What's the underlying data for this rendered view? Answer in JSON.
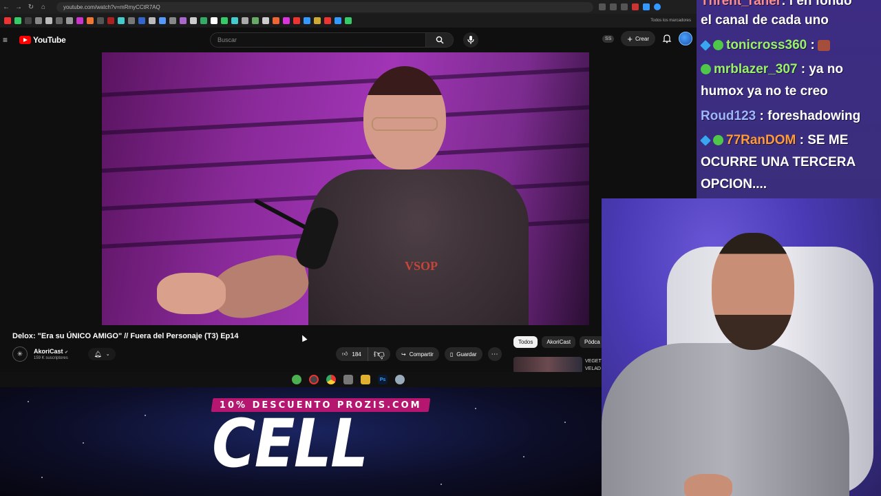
{
  "browser": {
    "url": "youtube.com/watch?v=mRmyCCtR7AQ",
    "bookmarks_label": "Todos los marcadores"
  },
  "youtube": {
    "logo_text": "YouTube",
    "search_placeholder": "Buscar",
    "ss_badge": "SS",
    "create_label": "Crear"
  },
  "video": {
    "title": "Delox: \"Era su ÚNICO AMIGO\" // Fuera del Personaje (T3) Ep14",
    "channel_name": "AkoriCast",
    "channel_verified": "✔",
    "subscribers": "159 K suscriptores",
    "likes": "184",
    "share_label": "Compartir",
    "save_label": "Guardar"
  },
  "chips": [
    "Todos",
    "AkoriCast",
    "Pódca"
  ],
  "recommended_title_lines": [
    "VEGET",
    "VELAD"
  ],
  "promo": {
    "banner": "10% DESCUENTO PROZIS.COM",
    "product": "CELL"
  },
  "chat": [
    {
      "user": "Thrent_raner",
      "msg": ": l en fondo",
      "color": "#ffffff"
    },
    {
      "user": "",
      "msg": "el canal de cada uno",
      "color": "#ffffff"
    },
    {
      "user": "tonicross360",
      "msg": ":",
      "color": "#9af26a",
      "badges": [
        "cube",
        "sub"
      ],
      "emote": true
    },
    {
      "user": "mrblazer_307",
      "msg": ": ya no",
      "color": "#9af26a",
      "badges": [
        "sub"
      ]
    },
    {
      "user": "",
      "msg": "humox ya no te creo",
      "color": "#ffffff"
    },
    {
      "user": "Roud123",
      "msg": ": foreshadowing",
      "color": "#9fb6ff"
    },
    {
      "user": "77RanDOM",
      "msg": ": SE ME",
      "color": "#ff9a3c",
      "badges": [
        "cube",
        "sub"
      ]
    },
    {
      "user": "",
      "msg": "OCURRE UNA TERCERA",
      "color": "#ffffff"
    },
    {
      "user": "",
      "msg": "OPCION....",
      "color": "#ffffff"
    }
  ],
  "colors": {
    "yt_red": "#ff0000",
    "chat_bg": "#3d2c83",
    "promo_banner": "#b5166f"
  }
}
